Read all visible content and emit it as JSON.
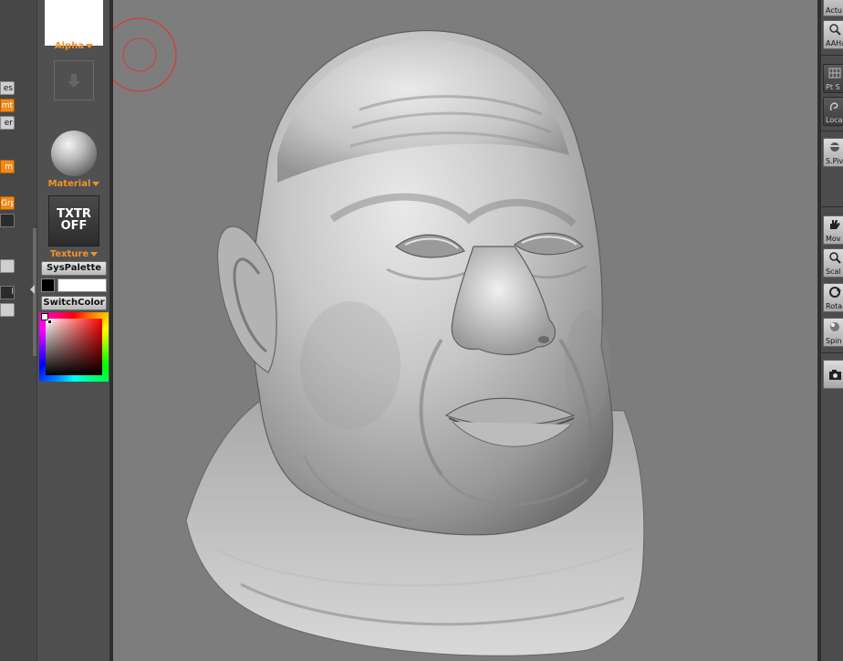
{
  "left_panel": {
    "tabs": [
      {
        "label": "es",
        "style": "gray"
      },
      {
        "label": "mt",
        "style": "orange"
      },
      {
        "label": "er",
        "style": "gray"
      },
      {
        "label": "m",
        "style": "orange"
      },
      {
        "label": "Grp",
        "style": "orange"
      },
      {
        "label": "",
        "style": "field"
      },
      {
        "label": "",
        "style": "gray"
      },
      {
        "label": "l",
        "style": "field"
      },
      {
        "label": "",
        "style": "gray"
      }
    ]
  },
  "tool_shelf": {
    "alpha_label": "Alpha",
    "material_label": "Material",
    "texture_button": "TXTR\nOFF",
    "texture_label": "Texture",
    "syspalette_button": "SysPalette",
    "switchcolor_button": "SwitchColor",
    "main_color": "#000000",
    "secondary_color": "#ffffff"
  },
  "canvas": {
    "background": "#7d7d7d",
    "brush_cursor_color": "#d83a3a"
  },
  "right_shelf": {
    "buttons": [
      {
        "label": "Actu",
        "icon": "actual-icon",
        "dark": false
      },
      {
        "label": "AAHa",
        "icon": "aahalf-icon",
        "dark": false
      },
      {
        "label": "Pt S",
        "icon": "grid-icon",
        "dark": true
      },
      {
        "label": "Loca",
        "icon": "local-icon",
        "dark": true
      },
      {
        "label": "S.Piv",
        "icon": "pivot-icon",
        "dark": false
      },
      {
        "label": "Mov",
        "icon": "hand-icon",
        "dark": false
      },
      {
        "label": "Scal",
        "icon": "scale-icon",
        "dark": false
      },
      {
        "label": "Rota",
        "icon": "rotate-icon",
        "dark": false
      },
      {
        "label": "Spin",
        "icon": "spin-icon",
        "dark": false
      },
      {
        "label": "",
        "icon": "camera-icon",
        "dark": false
      }
    ]
  }
}
